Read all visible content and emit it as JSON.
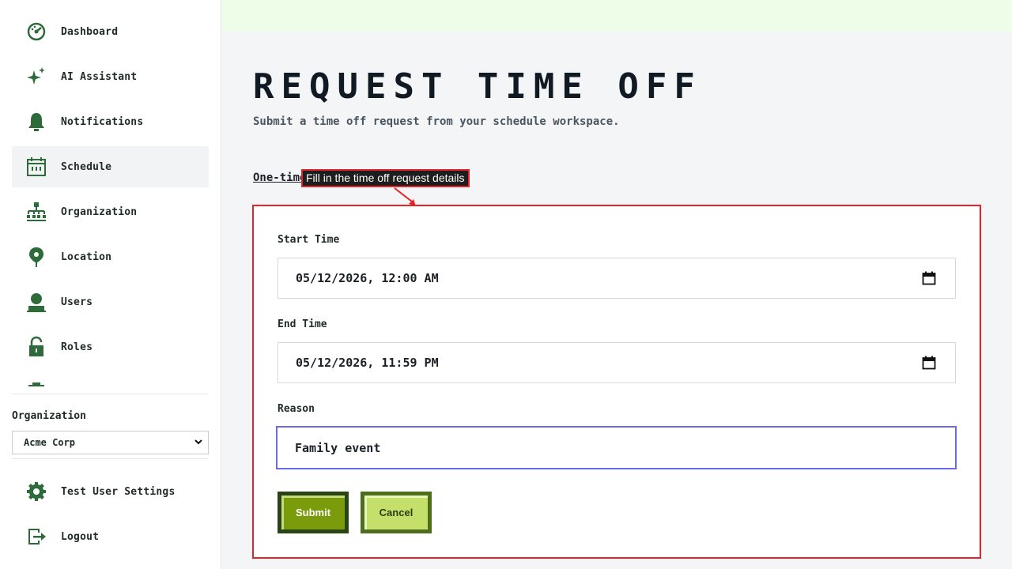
{
  "sidebar": {
    "items": [
      {
        "label": "Dashboard",
        "icon": "dashboard-icon"
      },
      {
        "label": "AI Assistant",
        "icon": "sparkle-icon"
      },
      {
        "label": "Notifications",
        "icon": "bell-icon"
      },
      {
        "label": "Schedule",
        "icon": "calendar-icon",
        "active": true
      },
      {
        "label": "Organization",
        "icon": "org-chart-icon"
      },
      {
        "label": "Location",
        "icon": "map-pin-icon"
      },
      {
        "label": "Users",
        "icon": "user-icon"
      },
      {
        "label": "Roles",
        "icon": "lock-icon"
      }
    ],
    "org_label": "Organization",
    "org_selected": "Acme Corp",
    "settings_label": "Test User Settings",
    "logout_label": "Logout"
  },
  "main": {
    "title": "REQUEST TIME OFF",
    "subtitle": "Submit a time off request from your schedule workspace.",
    "tab_label": "One-time",
    "callout": "Fill in the time off request details",
    "fields": {
      "start_label": "Start Time",
      "start_value": "05/12/2026, 12:00 AM",
      "end_label": "End Time",
      "end_value": "05/12/2026, 11:59 PM",
      "reason_label": "Reason",
      "reason_value": "Family event"
    },
    "submit_label": "Submit",
    "cancel_label": "Cancel"
  },
  "colors": {
    "accent_green": "#2e6b3a",
    "submit_bg": "#7a9c0c",
    "cancel_bg": "#c4e06a",
    "highlight_red": "#e3242b",
    "focus_blue": "#6b6bea",
    "top_strip": "#eefde8"
  }
}
